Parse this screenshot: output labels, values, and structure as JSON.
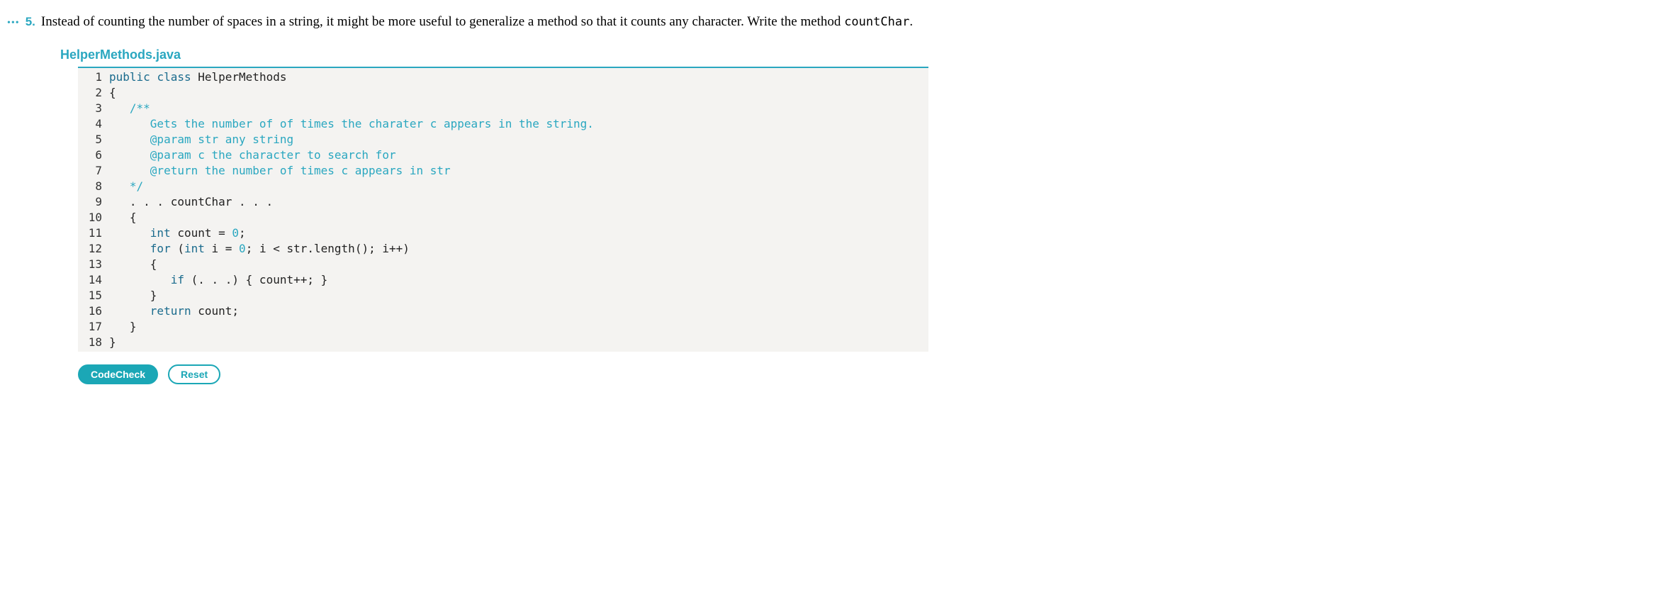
{
  "question": {
    "dots": "•••",
    "number": "5.",
    "text_before_code": "Instead of counting the number of spaces in a string, it might be more useful to generalize a method so that it counts any character. Write the method ",
    "code_term": "countChar",
    "text_after_code": "."
  },
  "filename": "HelperMethods.java",
  "code": {
    "lines": [
      {
        "n": "1",
        "segments": [
          {
            "cls": "kw",
            "t": "public"
          },
          {
            "cls": "plain",
            "t": " "
          },
          {
            "cls": "kw",
            "t": "class"
          },
          {
            "cls": "plain",
            "t": " HelperMethods"
          }
        ]
      },
      {
        "n": "2",
        "segments": [
          {
            "cls": "plain",
            "t": "{"
          }
        ]
      },
      {
        "n": "3",
        "segments": [
          {
            "cls": "plain",
            "t": "   "
          },
          {
            "cls": "comment",
            "t": "/**"
          }
        ]
      },
      {
        "n": "4",
        "segments": [
          {
            "cls": "comment",
            "t": "      Gets the number of of times the charater c appears in the string."
          }
        ]
      },
      {
        "n": "5",
        "segments": [
          {
            "cls": "comment",
            "t": "      @param str any string"
          }
        ]
      },
      {
        "n": "6",
        "segments": [
          {
            "cls": "comment",
            "t": "      @param c the character to search for"
          }
        ]
      },
      {
        "n": "7",
        "segments": [
          {
            "cls": "comment",
            "t": "      @return the number of times c appears in str"
          }
        ]
      },
      {
        "n": "8",
        "segments": [
          {
            "cls": "plain",
            "t": "   "
          },
          {
            "cls": "comment",
            "t": "*/"
          }
        ]
      },
      {
        "n": "9",
        "segments": [
          {
            "cls": "plain",
            "t": "   . . . countChar . . ."
          }
        ]
      },
      {
        "n": "10",
        "segments": [
          {
            "cls": "plain",
            "t": "   {"
          }
        ]
      },
      {
        "n": "11",
        "segments": [
          {
            "cls": "plain",
            "t": "      "
          },
          {
            "cls": "kw",
            "t": "int"
          },
          {
            "cls": "plain",
            "t": " count = "
          },
          {
            "cls": "comment",
            "t": "0"
          },
          {
            "cls": "plain",
            "t": ";"
          }
        ]
      },
      {
        "n": "12",
        "segments": [
          {
            "cls": "plain",
            "t": "      "
          },
          {
            "cls": "kw",
            "t": "for"
          },
          {
            "cls": "plain",
            "t": " ("
          },
          {
            "cls": "kw",
            "t": "int"
          },
          {
            "cls": "plain",
            "t": " i = "
          },
          {
            "cls": "comment",
            "t": "0"
          },
          {
            "cls": "plain",
            "t": "; i < str.length(); i++)"
          }
        ]
      },
      {
        "n": "13",
        "segments": [
          {
            "cls": "plain",
            "t": "      {"
          }
        ]
      },
      {
        "n": "14",
        "segments": [
          {
            "cls": "plain",
            "t": "         "
          },
          {
            "cls": "kw",
            "t": "if"
          },
          {
            "cls": "plain",
            "t": " (. . .) { count++; }"
          }
        ]
      },
      {
        "n": "15",
        "segments": [
          {
            "cls": "plain",
            "t": "      }"
          }
        ]
      },
      {
        "n": "16",
        "segments": [
          {
            "cls": "plain",
            "t": "      "
          },
          {
            "cls": "kw",
            "t": "return"
          },
          {
            "cls": "plain",
            "t": " count;"
          }
        ]
      },
      {
        "n": "17",
        "segments": [
          {
            "cls": "plain",
            "t": "   }"
          }
        ]
      },
      {
        "n": "18",
        "segments": [
          {
            "cls": "plain",
            "t": "}"
          }
        ]
      }
    ]
  },
  "buttons": {
    "codecheck": "CodeCheck",
    "reset": "Reset"
  }
}
